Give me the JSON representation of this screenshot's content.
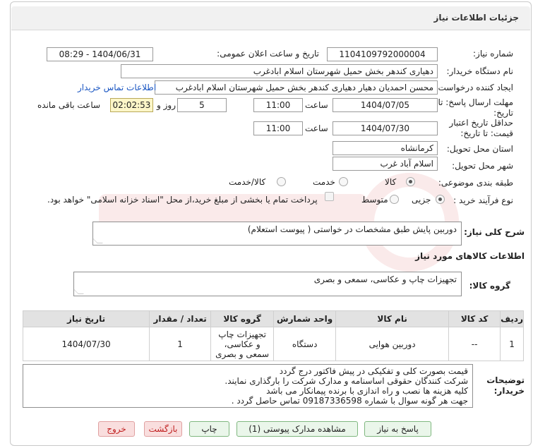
{
  "header": {
    "title": "جزئیات اطلاعات نیاز"
  },
  "need_number": {
    "label": "شماره نیاز:",
    "value": "1104109792000004"
  },
  "announce": {
    "label": "تاریخ و ساعت اعلان عمومی:",
    "value": "1404/06/31 - 08:29"
  },
  "buyer_org": {
    "label": "نام دستگاه خریدار:",
    "value": "دهیاری کندهر بخش حمیل شهرستان اسلام ابادغرب"
  },
  "requester": {
    "label": "ایجاد کننده درخواست:",
    "value": "محسن احمدیان دهیار دهیاری کندهر بخش حمیل شهرستان اسلام ابادغرب",
    "contact_link": "اطلاعات تماس خریدار"
  },
  "deadline": {
    "label_line1": "مهلت ارسال پاسخ: تا",
    "label_line2": "تاریخ:",
    "date": "1404/07/05",
    "time_label": "ساعت",
    "time": "11:00",
    "days": "5",
    "days_label": "روز و",
    "remaining": "02:02:53",
    "remaining_label": "ساعت باقی مانده"
  },
  "validity": {
    "label_line1": "حداقل تاریخ اعتبار",
    "label_line2": "قیمت: تا تاریخ:",
    "date": "1404/07/30",
    "time_label": "ساعت",
    "time": "11:00"
  },
  "province": {
    "label": "استان محل تحویل:",
    "value": "کرمانشاه"
  },
  "city": {
    "label": "شهر محل تحویل:",
    "value": "اسلام آباد غرب"
  },
  "category": {
    "label": "طبقه بندی موضوعی:",
    "options": [
      "کالا",
      "خدمت",
      "کالا/خدمت"
    ],
    "selected": "کالا"
  },
  "process": {
    "label": "نوع فرآیند خرید :",
    "options": [
      "جزیی",
      "متوسط"
    ],
    "selected": "جزیی",
    "note": "پرداخت تمام یا بخشی از مبلغ خرید،از محل \"اسناد خزانه اسلامی\" خواهد بود."
  },
  "need_summary": {
    "label": "شرح کلی نیاز:",
    "value": "دوربین پایش طبق مشخصات در خواستی (  پیوست استعلام)"
  },
  "goods_section": {
    "title": "اطلاعات کالاهای مورد نیاز"
  },
  "goods_group": {
    "label": "گروه کالا:",
    "value": "تجهیزات چاپ و عکاسی، سمعی و بصری"
  },
  "table": {
    "headers": [
      "ردیف",
      "کد کالا",
      "نام کالا",
      "واحد شمارش",
      "گروه کالا",
      "تعداد / مقدار",
      "تاریخ نیاز"
    ],
    "rows": [
      [
        "1",
        "--",
        "دوربین هوایی",
        "دستگاه",
        "تجهیزات چاپ و عکاسی، سمعی و بصری",
        "1",
        "1404/07/30"
      ]
    ]
  },
  "buyer_notes": {
    "label_line1": "توضیحات",
    "label_line2": "خریدار:",
    "lines": [
      "قیمت بصورت کلی و تفکیکی در پیش فاکتور درج گردد",
      "شرکت کنندگان حقوقی اساسنامه و مدارک شرکت را بارگذاری نمایند.",
      "کلیه هزینه ها نصب و راه اندازی با برنده پیمانکار می باشد",
      "جهت هر گونه سوال با شماره 09187336598 تماس حاصل گردد ."
    ]
  },
  "buttons": {
    "reply": "پاسخ به نیاز",
    "view_docs": "مشاهده مدارک پیوستی (1)",
    "print": "چاپ",
    "back": "بازگشت",
    "exit": "خروج"
  },
  "colors": {
    "link": "#1a56c2",
    "green_button": "#eaf6ea",
    "red_button": "#f9dede",
    "timer_bg": "#fdf6c8"
  }
}
